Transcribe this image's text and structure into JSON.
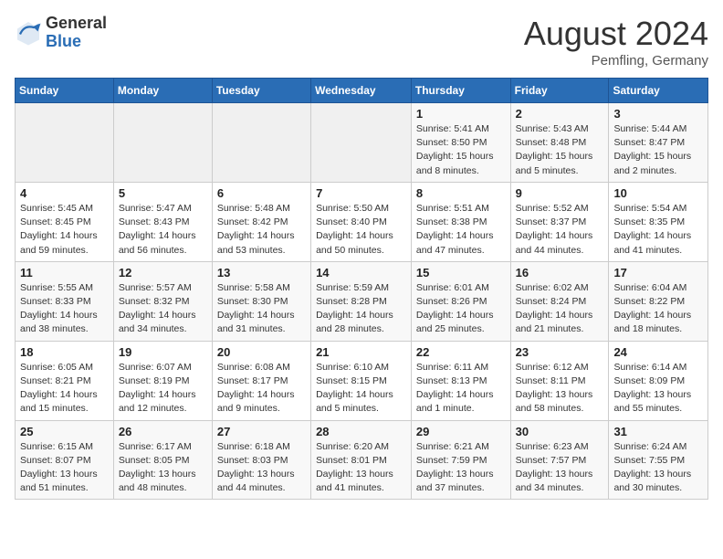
{
  "header": {
    "logo_general": "General",
    "logo_blue": "Blue",
    "month_title": "August 2024",
    "location": "Pemfling, Germany"
  },
  "weekdays": [
    "Sunday",
    "Monday",
    "Tuesday",
    "Wednesday",
    "Thursday",
    "Friday",
    "Saturday"
  ],
  "weeks": [
    [
      {
        "day": "",
        "info": ""
      },
      {
        "day": "",
        "info": ""
      },
      {
        "day": "",
        "info": ""
      },
      {
        "day": "",
        "info": ""
      },
      {
        "day": "1",
        "info": "Sunrise: 5:41 AM\nSunset: 8:50 PM\nDaylight: 15 hours\nand 8 minutes."
      },
      {
        "day": "2",
        "info": "Sunrise: 5:43 AM\nSunset: 8:48 PM\nDaylight: 15 hours\nand 5 minutes."
      },
      {
        "day": "3",
        "info": "Sunrise: 5:44 AM\nSunset: 8:47 PM\nDaylight: 15 hours\nand 2 minutes."
      }
    ],
    [
      {
        "day": "4",
        "info": "Sunrise: 5:45 AM\nSunset: 8:45 PM\nDaylight: 14 hours\nand 59 minutes."
      },
      {
        "day": "5",
        "info": "Sunrise: 5:47 AM\nSunset: 8:43 PM\nDaylight: 14 hours\nand 56 minutes."
      },
      {
        "day": "6",
        "info": "Sunrise: 5:48 AM\nSunset: 8:42 PM\nDaylight: 14 hours\nand 53 minutes."
      },
      {
        "day": "7",
        "info": "Sunrise: 5:50 AM\nSunset: 8:40 PM\nDaylight: 14 hours\nand 50 minutes."
      },
      {
        "day": "8",
        "info": "Sunrise: 5:51 AM\nSunset: 8:38 PM\nDaylight: 14 hours\nand 47 minutes."
      },
      {
        "day": "9",
        "info": "Sunrise: 5:52 AM\nSunset: 8:37 PM\nDaylight: 14 hours\nand 44 minutes."
      },
      {
        "day": "10",
        "info": "Sunrise: 5:54 AM\nSunset: 8:35 PM\nDaylight: 14 hours\nand 41 minutes."
      }
    ],
    [
      {
        "day": "11",
        "info": "Sunrise: 5:55 AM\nSunset: 8:33 PM\nDaylight: 14 hours\nand 38 minutes."
      },
      {
        "day": "12",
        "info": "Sunrise: 5:57 AM\nSunset: 8:32 PM\nDaylight: 14 hours\nand 34 minutes."
      },
      {
        "day": "13",
        "info": "Sunrise: 5:58 AM\nSunset: 8:30 PM\nDaylight: 14 hours\nand 31 minutes."
      },
      {
        "day": "14",
        "info": "Sunrise: 5:59 AM\nSunset: 8:28 PM\nDaylight: 14 hours\nand 28 minutes."
      },
      {
        "day": "15",
        "info": "Sunrise: 6:01 AM\nSunset: 8:26 PM\nDaylight: 14 hours\nand 25 minutes."
      },
      {
        "day": "16",
        "info": "Sunrise: 6:02 AM\nSunset: 8:24 PM\nDaylight: 14 hours\nand 21 minutes."
      },
      {
        "day": "17",
        "info": "Sunrise: 6:04 AM\nSunset: 8:22 PM\nDaylight: 14 hours\nand 18 minutes."
      }
    ],
    [
      {
        "day": "18",
        "info": "Sunrise: 6:05 AM\nSunset: 8:21 PM\nDaylight: 14 hours\nand 15 minutes."
      },
      {
        "day": "19",
        "info": "Sunrise: 6:07 AM\nSunset: 8:19 PM\nDaylight: 14 hours\nand 12 minutes."
      },
      {
        "day": "20",
        "info": "Sunrise: 6:08 AM\nSunset: 8:17 PM\nDaylight: 14 hours\nand 9 minutes."
      },
      {
        "day": "21",
        "info": "Sunrise: 6:10 AM\nSunset: 8:15 PM\nDaylight: 14 hours\nand 5 minutes."
      },
      {
        "day": "22",
        "info": "Sunrise: 6:11 AM\nSunset: 8:13 PM\nDaylight: 14 hours\nand 1 minute."
      },
      {
        "day": "23",
        "info": "Sunrise: 6:12 AM\nSunset: 8:11 PM\nDaylight: 13 hours\nand 58 minutes."
      },
      {
        "day": "24",
        "info": "Sunrise: 6:14 AM\nSunset: 8:09 PM\nDaylight: 13 hours\nand 55 minutes."
      }
    ],
    [
      {
        "day": "25",
        "info": "Sunrise: 6:15 AM\nSunset: 8:07 PM\nDaylight: 13 hours\nand 51 minutes."
      },
      {
        "day": "26",
        "info": "Sunrise: 6:17 AM\nSunset: 8:05 PM\nDaylight: 13 hours\nand 48 minutes."
      },
      {
        "day": "27",
        "info": "Sunrise: 6:18 AM\nSunset: 8:03 PM\nDaylight: 13 hours\nand 44 minutes."
      },
      {
        "day": "28",
        "info": "Sunrise: 6:20 AM\nSunset: 8:01 PM\nDaylight: 13 hours\nand 41 minutes."
      },
      {
        "day": "29",
        "info": "Sunrise: 6:21 AM\nSunset: 7:59 PM\nDaylight: 13 hours\nand 37 minutes."
      },
      {
        "day": "30",
        "info": "Sunrise: 6:23 AM\nSunset: 7:57 PM\nDaylight: 13 hours\nand 34 minutes."
      },
      {
        "day": "31",
        "info": "Sunrise: 6:24 AM\nSunset: 7:55 PM\nDaylight: 13 hours\nand 30 minutes."
      }
    ]
  ]
}
